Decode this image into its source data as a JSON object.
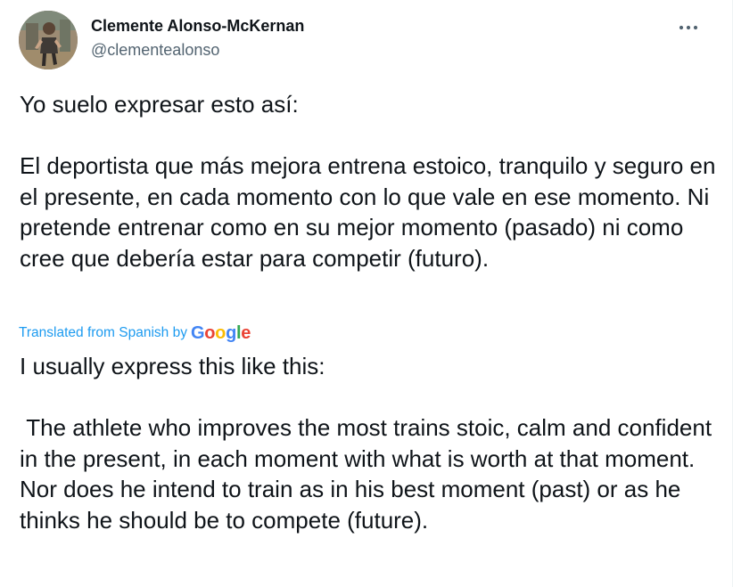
{
  "author": {
    "display_name": "Clemente Alonso-McKernan",
    "handle": "@clementealonso",
    "avatar_icon": "user-avatar-photo"
  },
  "more_icon": "more-horizontal-icon",
  "tweet": {
    "original_text": "Yo suelo expresar esto así:\n\nEl deportista que más mejora entrena estoico, tranquilo y seguro en el presente, en cada momento con lo que vale en ese momento. Ni pretende entrenar como en su mejor momento (pasado) ni como cree que debería estar para competir (futuro).",
    "translation_credit": "Translated from Spanish by",
    "translation_provider": "Google",
    "translated_text": "I usually express this like this:\n\n The athlete who improves the most trains stoic, calm and confident in the present, in each moment with what is worth at that moment. Nor does he intend to train as in his best moment (past) or as he thinks he should be to compete (future)."
  },
  "colors": {
    "text_primary": "#0f1419",
    "text_secondary": "#536471",
    "link_blue": "#1d9bf0",
    "google_blue": "#4285f4",
    "google_red": "#ea4335",
    "google_yellow": "#fbbc05",
    "google_green": "#34a853"
  }
}
